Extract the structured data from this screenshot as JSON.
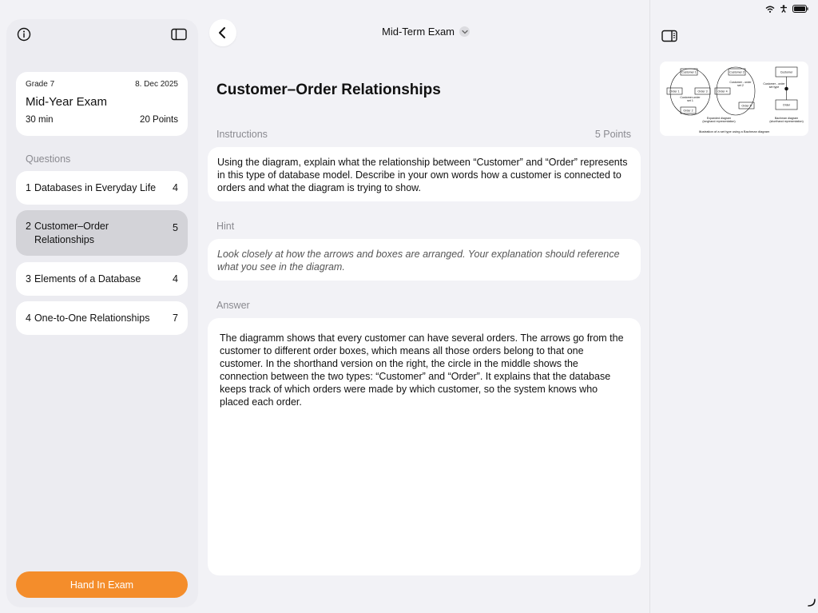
{
  "sidebar": {
    "exam": {
      "grade": "Grade 7",
      "date": "8. Dec 2025",
      "title": "Mid-Year Exam",
      "duration": "30 min",
      "points": "20 Points"
    },
    "questions_label": "Questions",
    "questions": [
      {
        "num": "1",
        "label": "Databases in Everyday Life",
        "points": "4",
        "active": false
      },
      {
        "num": "2",
        "label": "Customer–Order Relationships",
        "points": "5",
        "active": true
      },
      {
        "num": "3",
        "label": "Elements of a Database",
        "points": "4",
        "active": false
      },
      {
        "num": "4",
        "label": "One-to-One Relationships",
        "points": "7",
        "active": false
      }
    ],
    "hand_in_label": "Hand In Exam"
  },
  "header": {
    "title": "Mid-Term Exam"
  },
  "question": {
    "title": "Customer–Order Relationships",
    "instructions_label": "Instructions",
    "points": "5 Points",
    "instructions": "Using the diagram, explain what the relationship between “Customer” and “Order” represents in this type of database model. Describe in your own words how a customer is connected to orders and what the diagram is trying to show.",
    "hint_label": "Hint",
    "hint": "Look closely at how the arrows and boxes are arranged. Your explanation should reference what you see in the diagram.",
    "answer_label": "Answer",
    "answer": "The diagramm shows that every customer can have several orders. The arrows go from the customer to different order boxes, which means all those orders belong to that one customer. In the shorthand version on the right, the circle in the middle shows the connection between the two types: “Customer” and “Order”. It explains that the database keeps track of which orders were made by which customer, so the system knows who placed each order."
  },
  "diagram": {
    "customer1": "Customer 1",
    "customer2": "Customer 2",
    "customer": "Customer",
    "order1": "Order 1",
    "order2": "Order 2",
    "order3": "Order 3",
    "order4": "Order 4",
    "order5": "Order 5",
    "order": "Order",
    "set1_line1": "Customer-order",
    "set1_line2": "set 1",
    "set2_line1": "Customer - order",
    "set2_line2": "set 2",
    "settype_line1": "Customer - order",
    "settype_line2": "set type",
    "expanded_line1": "Expanded diagram",
    "expanded_line2": "(longhand representation)",
    "bachman_line1": "Bachman diagram",
    "bachman_line2": "(shorthand representation)",
    "caption": "Illustration of a set type using a Bachman diagram"
  },
  "colors": {
    "accent": "#f48d2b",
    "active_item": "#d3d3d8",
    "background": "#f2f2f6"
  }
}
